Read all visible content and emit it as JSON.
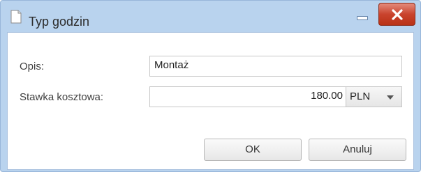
{
  "window": {
    "title": "Typ godzin",
    "icon": "document-icon",
    "minimize_icon": "minimize-icon",
    "close_icon": "close-icon"
  },
  "form": {
    "description": {
      "label": "Opis:",
      "value": "Montaż"
    },
    "cost_rate": {
      "label": "Stawka kosztowa:",
      "value": "180.00",
      "currency": "PLN"
    }
  },
  "buttons": {
    "ok": "OK",
    "cancel": "Anuluj"
  },
  "colors": {
    "titlebar": "#b9d3ee",
    "close_button": "#c9432d"
  }
}
